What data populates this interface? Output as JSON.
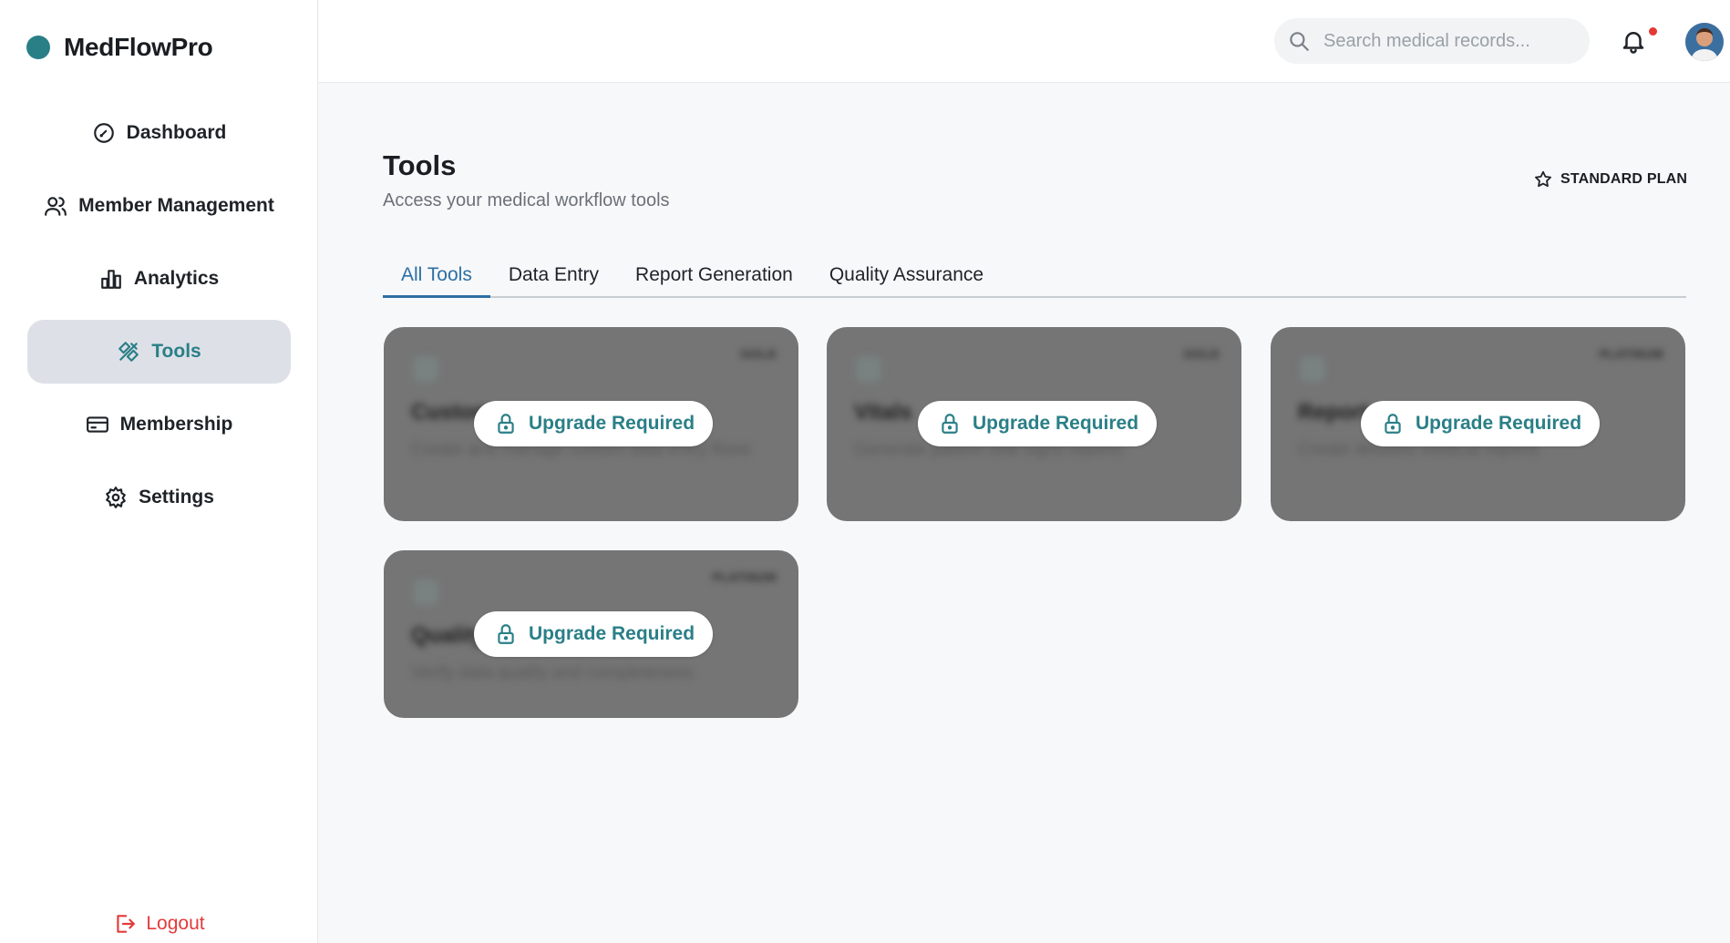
{
  "brand": {
    "name": "MedFlowPro",
    "accent": "#2a7f87"
  },
  "sidebar": {
    "items": [
      {
        "label": "Dashboard",
        "icon": "gauge-icon"
      },
      {
        "label": "Member Management",
        "icon": "users-icon"
      },
      {
        "label": "Analytics",
        "icon": "bar-chart-icon"
      },
      {
        "label": "Tools",
        "icon": "tools-icon",
        "active": true
      },
      {
        "label": "Membership",
        "icon": "card-icon"
      },
      {
        "label": "Settings",
        "icon": "gear-icon"
      }
    ],
    "logout_label": "Logout"
  },
  "header": {
    "search_placeholder": "Search medical records...",
    "notifications": {
      "icon": "bell-icon",
      "has_unread": true
    },
    "avatar": "user-avatar"
  },
  "main": {
    "title": "Tools",
    "subtitle": "Access your medical workflow tools",
    "plan_label": "STANDARD PLAN",
    "tabs": [
      "All Tools",
      "Data Entry",
      "Report Generation",
      "Quality Assurance"
    ],
    "active_tab": "All Tools",
    "cards": [
      {
        "name": "Custom",
        "tier": "GOLD",
        "description": "Create and manage custom data entry flows",
        "locked_label": "Upgrade Required"
      },
      {
        "name": "Vitals",
        "tier": "GOLD",
        "description": "Generate patient vital signs reports",
        "locked_label": "Upgrade Required"
      },
      {
        "name": "Report",
        "tier": "PLATINUM",
        "description": "Create detailed medical reports",
        "locked_label": "Upgrade Required"
      },
      {
        "name": "Quality",
        "tier": "PLATINUM",
        "description": "Verify data quality and completeness",
        "locked_label": "Upgrade Required"
      }
    ]
  }
}
